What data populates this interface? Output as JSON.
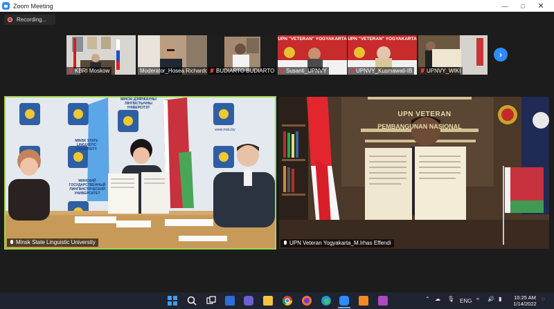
{
  "window": {
    "title": "Zoom Meeting",
    "controls": [
      "minimize",
      "maximize",
      "close"
    ]
  },
  "recording": {
    "label": "Recording..."
  },
  "thumbnails": [
    {
      "name": "KBRI Moskow",
      "muted": true
    },
    {
      "name": "Moderator_Hosea Richardo",
      "muted": true
    },
    {
      "name": "BUDIARTO BUDIARTO",
      "muted": true
    },
    {
      "name": "Susanti_UPNVY",
      "muted": true,
      "banner": "UPN \"VETERAN\" YOGYAKARTA"
    },
    {
      "name": "UPNVY_Kusmawati-IB",
      "muted": true,
      "banner": "UPN \"VETERAN\" YOGYAKARTA"
    },
    {
      "name": "UPNVY_WIKI",
      "muted": true
    }
  ],
  "main_tiles": [
    {
      "name": "Minsk State Linguistic University",
      "active_speaker": true,
      "backdrop_text": [
        "МІНСКІ ДЗЯРЖАЎНЫ ЛІНГВІСТЫЧНЫ УНІВЕРСІТЭТ",
        "MINSK STATE LINGUISTIC UNIVERSITY",
        "МИНСКИЙ ГОСУДАРСТВЕННЫЙ ЛИНГВИСТИЧЕСКИЙ УНИВЕРСИТЕТ",
        "www.mslu.by"
      ]
    },
    {
      "name": "UPN Veteran Yogyakarta_M.Irhas Effendi",
      "active_speaker": false,
      "backdrop_text": [
        "UPN VETERAN",
        "PEMBANGUNAN NASIONAL"
      ]
    }
  ],
  "taskbar": {
    "apps": [
      "windows-start",
      "search",
      "task-view",
      "widgets",
      "teams-chat",
      "file-explorer",
      "chrome",
      "firefox",
      "edge",
      "zoom",
      "app-orange",
      "app-purple"
    ],
    "tray": {
      "language": "ENG"
    },
    "clock": {
      "time": "10:25 AM",
      "date": "1/14/2022"
    }
  },
  "colors": {
    "zoom_blue": "#2d8cff",
    "active_speaker_border": "#9fd64c",
    "recording_red": "#e02b2b",
    "taskbar_bg": "#1f2430"
  }
}
